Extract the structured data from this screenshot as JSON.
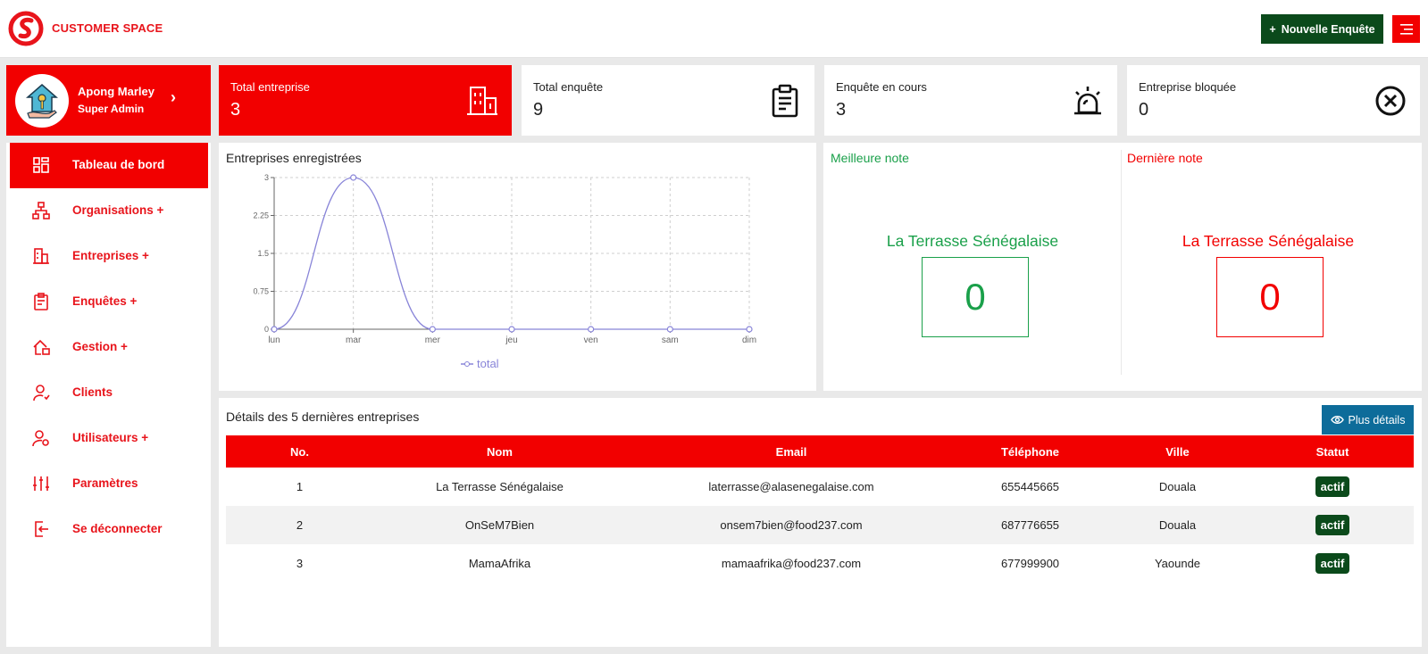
{
  "header": {
    "brand": "CUSTOMER SPACE",
    "new_survey_label": "Nouvelle Enquête",
    "new_survey_plus": "+"
  },
  "profile": {
    "name": "Apong Marley",
    "role": "Super Admin",
    "arrow": "›"
  },
  "stats": [
    {
      "label": "Total entreprise",
      "value": "3",
      "icon": "building-icon"
    },
    {
      "label": "Total enquête",
      "value": "9",
      "icon": "clipboard-icon"
    },
    {
      "label": "Enquête en cours",
      "value": "3",
      "icon": "alarm-icon"
    },
    {
      "label": "Entreprise bloquée",
      "value": "0",
      "icon": "close-circle-icon"
    }
  ],
  "sidebar": {
    "items": [
      {
        "label": "Tableau de bord",
        "icon": "dashboard-icon",
        "active": true
      },
      {
        "label": "Organisations +",
        "icon": "org-icon"
      },
      {
        "label": "Entreprises +",
        "icon": "building-icon"
      },
      {
        "label": "Enquêtes +",
        "icon": "clipboard-icon"
      },
      {
        "label": "Gestion +",
        "icon": "home-manage-icon"
      },
      {
        "label": "Clients",
        "icon": "user-heart-icon"
      },
      {
        "label": "Utilisateurs +",
        "icon": "user-gear-icon"
      },
      {
        "label": "Paramètres",
        "icon": "sliders-icon"
      },
      {
        "label": "Se déconnecter",
        "icon": "logout-icon"
      }
    ]
  },
  "chart_data": {
    "type": "line",
    "title": "Entreprises enregistrées",
    "categories": [
      "lun",
      "mar",
      "mer",
      "jeu",
      "ven",
      "sam",
      "dim"
    ],
    "series": [
      {
        "name": "total",
        "values": [
          0,
          3,
          0,
          0,
          0,
          0,
          0
        ],
        "color": "#8884d8"
      }
    ],
    "yticks": [
      "0",
      "0.75",
      "1.5",
      "2.25",
      "3"
    ],
    "ylim": [
      0,
      3
    ],
    "grid": true,
    "legend": "bottom"
  },
  "notes": {
    "best": {
      "title": "Meilleure note",
      "name": "La Terrasse Sénégalaise",
      "value": "0",
      "color": "#1aa04a"
    },
    "last": {
      "title": "Dernière note",
      "name": "La Terrasse Sénégalaise",
      "value": "0",
      "color": "#f20000"
    }
  },
  "table": {
    "title": "Détails des 5 dernières entreprises",
    "more_label": "Plus détails",
    "columns": [
      "No.",
      "Nom",
      "Email",
      "Téléphone",
      "Ville",
      "Statut"
    ],
    "rows": [
      [
        "1",
        "La Terrasse Sénégalaise",
        "laterrasse@alasenegalaise.com",
        "655445665",
        "Douala",
        "actif"
      ],
      [
        "2",
        "OnSeM7Bien",
        "onsem7bien@food237.com",
        "687776655",
        "Douala",
        "actif"
      ],
      [
        "3",
        "MamaAfrika",
        "mamaafrika@food237.com",
        "677999900",
        "Yaounde",
        "actif"
      ]
    ]
  }
}
